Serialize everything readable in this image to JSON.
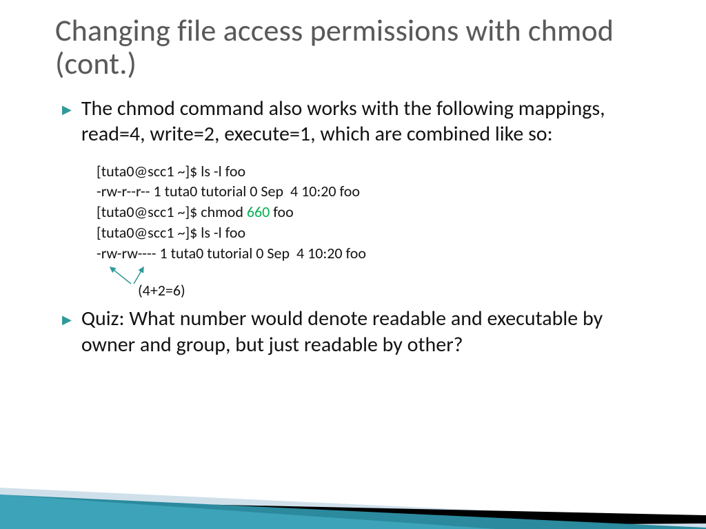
{
  "title": "Changing file access permissions with chmod (cont.)",
  "bullets": {
    "intro": "The chmod command also works with the following mappings, read=4, write=2, execute=1, which are combined like so:",
    "quiz": "Quiz: What number would denote readable and executable by owner and group, but just readable by other?"
  },
  "code": {
    "line1": "[tuta0@scc1 ~]$ ls -l foo",
    "line2": "-rw-r--r-- 1 tuta0 tutorial 0 Sep  4 10:20 foo",
    "line3_pre": "[tuta0@scc1 ~]$ chmod ",
    "line3_hl": "660",
    "line3_post": " foo",
    "line4": "[tuta0@scc1 ~]$ ls -l foo",
    "line5": "-rw-rw---- 1 tuta0 tutorial 0 Sep  4 10:20 foo"
  },
  "note": "(4+2=6)"
}
